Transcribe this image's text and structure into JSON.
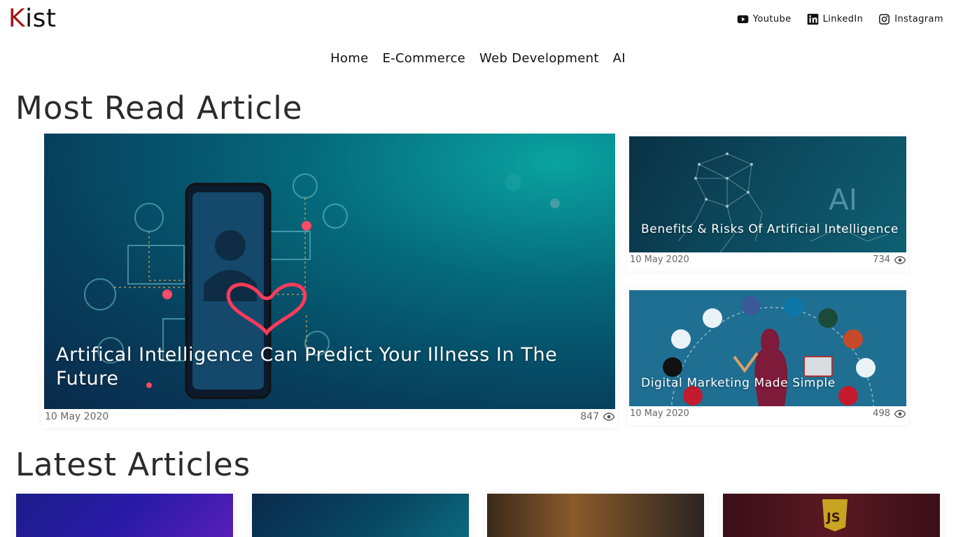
{
  "brand": {
    "first": "K",
    "rest": "ist",
    "accent": "#a01818"
  },
  "social": [
    {
      "label": "Youtube",
      "icon": "youtube-icon"
    },
    {
      "label": "LinkedIn",
      "icon": "linkedin-icon"
    },
    {
      "label": "Instagram",
      "icon": "instagram-icon"
    }
  ],
  "nav": [
    "Home",
    "E-Commerce",
    "Web Development",
    "AI"
  ],
  "most_read": {
    "title": "Most Read Article",
    "featured": {
      "title": "Artifical Intelligence Can Predict Your Illness In The Future",
      "date": "10 May 2020",
      "views": "847"
    },
    "side": [
      {
        "title": "Benefits & Risks Of Artificial Intelligence",
        "date": "10 May 2020",
        "views": "734"
      },
      {
        "title": "Digital Marketing Made Simple",
        "date": "10 May 2020",
        "views": "498"
      }
    ]
  },
  "latest": {
    "title": "Latest Articles"
  }
}
